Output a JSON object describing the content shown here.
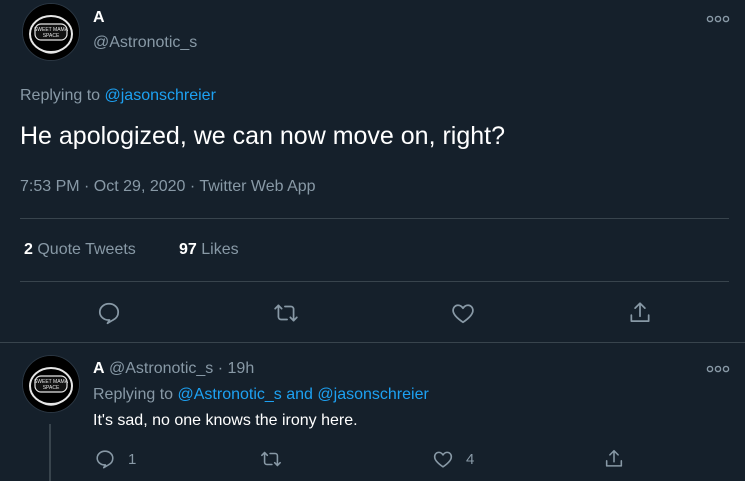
{
  "main_tweet": {
    "display_name": "A",
    "handle": "@Astronotic_s",
    "avatar_text": "SWEET MAMA SPACE",
    "replying_prefix": "Replying to",
    "replying_to": "@jasonschreier",
    "text": "He apologized, we can now move on, right?",
    "timestamp": "7:53 PM · Oct 29, 2020 · Twitter Web App",
    "stats": {
      "quote_count": "2",
      "quote_label": "Quote Tweets",
      "like_count": "97",
      "like_label": "Likes"
    },
    "actions": [
      "reply-icon",
      "retweet-icon",
      "like-icon",
      "share-icon"
    ]
  },
  "reply_tweet": {
    "display_name": "A",
    "handle": "@Astronotic_s",
    "separator": "·",
    "time": "19h",
    "avatar_text": "SWEET MAMA SPACE",
    "replying_prefix": "Replying to",
    "replying_to_1": "@Astronotic_s",
    "replying_and": "and",
    "replying_to_2": "@jasonschreier",
    "text": "It's sad, no one knows the irony here.",
    "reply_count": "1",
    "like_count": "4"
  },
  "colors": {
    "background": "#15202b",
    "text": "#ffffff",
    "muted": "#8899a6",
    "link": "#1da1f2",
    "divider": "#38444d"
  }
}
